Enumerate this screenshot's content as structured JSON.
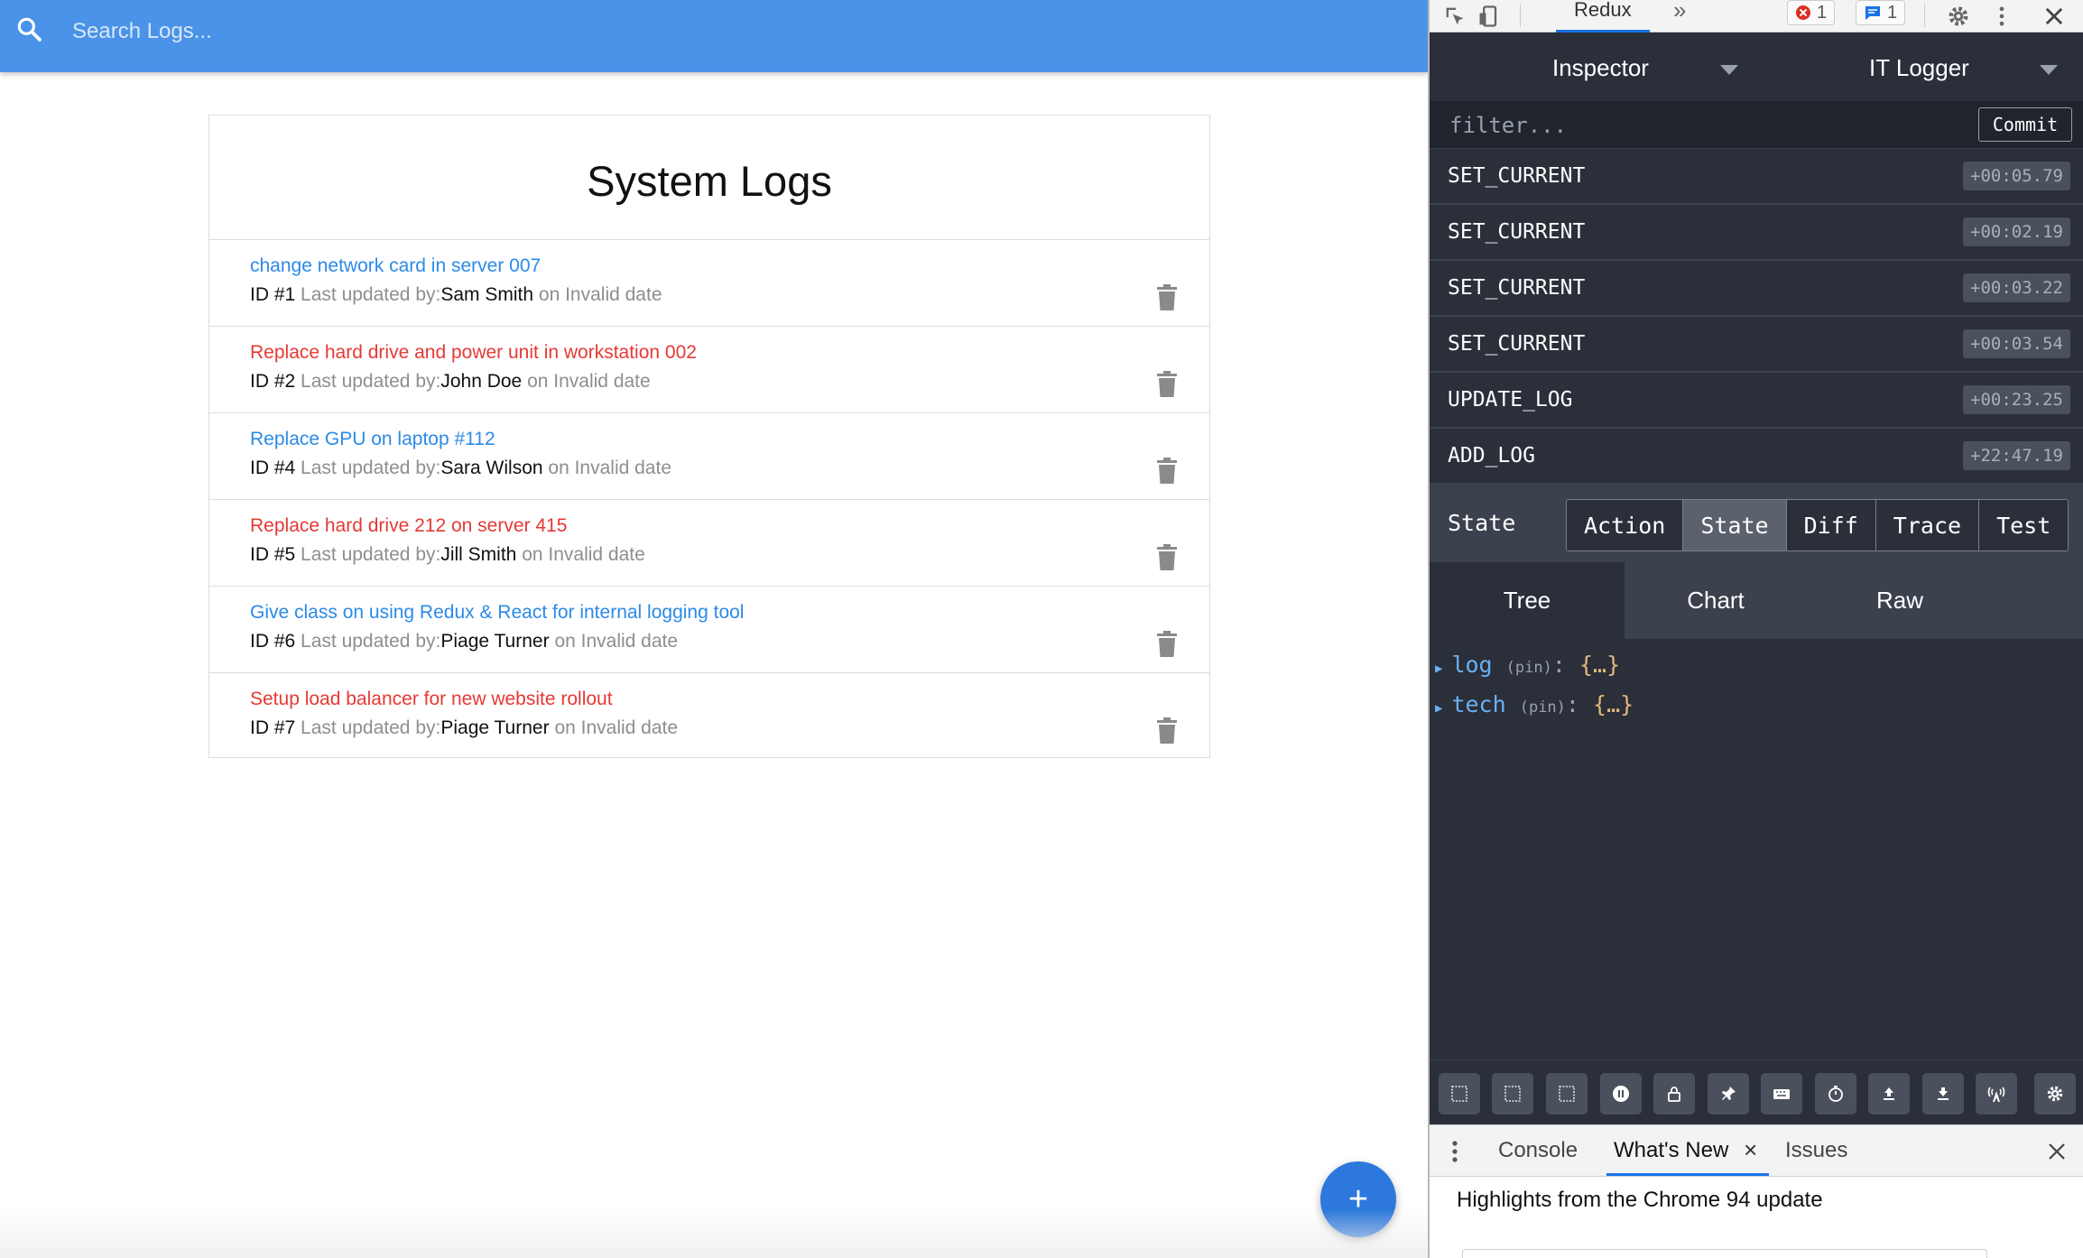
{
  "app": {
    "search": {
      "placeholder": "Search Logs..."
    },
    "title": "System Logs",
    "logs": [
      {
        "message": "change network card in server 007",
        "attention": false,
        "id_label": "ID #1",
        "updated_label": "Last updated by:",
        "tech": "Sam Smith",
        "date_text": "on Invalid date"
      },
      {
        "message": "Replace hard drive and power unit in workstation 002",
        "attention": true,
        "id_label": "ID #2",
        "updated_label": "Last updated by:",
        "tech": "John Doe",
        "date_text": "on Invalid date"
      },
      {
        "message": "Replace GPU on laptop #112",
        "attention": false,
        "id_label": "ID #4",
        "updated_label": "Last updated by:",
        "tech": "Sara Wilson",
        "date_text": "on Invalid date"
      },
      {
        "message": "Replace hard drive 212 on server 415",
        "attention": true,
        "id_label": "ID #5",
        "updated_label": "Last updated by:",
        "tech": "Jill Smith",
        "date_text": "on Invalid date"
      },
      {
        "message": "Give class on using Redux & React for internal logging tool",
        "attention": false,
        "id_label": "ID #6",
        "updated_label": "Last updated by:",
        "tech": "Piage Turner",
        "date_text": "on Invalid date"
      },
      {
        "message": "Setup load balancer for new website rollout",
        "attention": true,
        "id_label": "ID #7",
        "updated_label": "Last updated by:",
        "tech": "Piage Turner",
        "date_text": "on Invalid date"
      }
    ],
    "add_button": "+",
    "colors": {
      "header": "#4a93e8",
      "link": "#2b8ae8",
      "attention": "#e53935",
      "fab": "#2c78dc"
    }
  },
  "devtools": {
    "toolbar": {
      "active_tab": "Redux",
      "more_tabs": "»",
      "errors_count": "1",
      "messages_count": "1"
    },
    "instance_select": "Inspector",
    "store_select": "IT Logger",
    "filter_placeholder": "filter...",
    "commit_label": "Commit",
    "actions": [
      {
        "name": "SET_CURRENT",
        "time": "+00:05.79"
      },
      {
        "name": "SET_CURRENT",
        "time": "+00:02.19"
      },
      {
        "name": "SET_CURRENT",
        "time": "+00:03.22"
      },
      {
        "name": "SET_CURRENT",
        "time": "+00:03.54"
      },
      {
        "name": "UPDATE_LOG",
        "time": "+00:23.25"
      },
      {
        "name": "ADD_LOG",
        "time": "+22:47.19"
      }
    ],
    "monitor_label": "State",
    "monitor_tabs": [
      "Action",
      "State",
      "Diff",
      "Trace",
      "Test"
    ],
    "monitor_active": "State",
    "view_tabs": [
      "Tree",
      "Chart",
      "Raw"
    ],
    "view_active": "Tree",
    "tree": [
      {
        "key": "log",
        "pin": "(pin)",
        "colon": ":",
        "value": "{…}"
      },
      {
        "key": "tech",
        "pin": "(pin)",
        "colon": ":",
        "value": "{…}"
      }
    ],
    "drawer": {
      "tabs": [
        "Console",
        "What's New",
        "Issues"
      ],
      "active": "What's New",
      "close_tab": "×",
      "headline": "Highlights from the Chrome 94 update"
    }
  }
}
